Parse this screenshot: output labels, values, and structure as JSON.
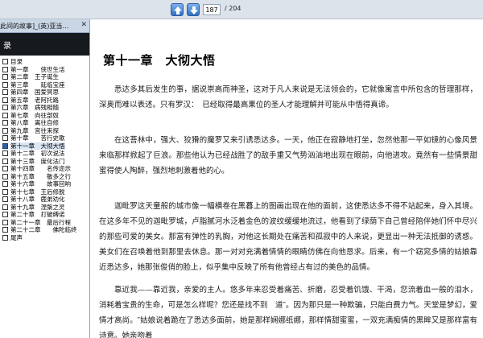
{
  "toolbar": {
    "page_value": "187",
    "page_total": "/ 204"
  },
  "tab": {
    "label": "此间的故事]_(英)亚当…",
    "close": "✕"
  },
  "sidebar": {
    "title": "录",
    "items": [
      "目录",
      "第一章　　侠世生活",
      "第二章　王子诞生",
      "第三章　　延临宝座",
      "第四章　国爱冥思",
      "第五章　老阿托路",
      "第六章　病残相随",
      "第七章　向往部奴",
      "第八章　离往自修",
      "第九章　宫往来探",
      "第十章　　苦行史歌",
      "第十一章　大彻大悟",
      "第十二章　初次说法",
      "第十三章　度化法门",
      "第十四章　　名传迩示",
      "第十五章　　敬多之行",
      "第十六章　　故事回响",
      "第十七章　王后修脱",
      "第十八章　鹿弟劝化",
      "第十九章　涅槃之灵",
      "第二十章　打破缚诺",
      "第二十一章　最后行程",
      "第二十二章　　佛陀临终",
      "尾声"
    ],
    "selected_index": 11
  },
  "content": {
    "title": "第十一章　大彻大悟",
    "paragraphs": [
      "悉达多其后发生的事，据说崇高而神圣，这对于凡人来说是无法领会的，它就像寓言中所包含的哲理那样，深奥而难以表述。只有罗汉：　已经取得最高果位的圣人才能理解并可能从中悟得真谛。",
      "在这菩林中，强大、狡猾的魔罗又来引诱悉达多。一天，他正在寂静地打坐，忽然他那一平如镜的心像风景来临那样掀起了巨浪。那些他认为已经战胜了的敌手重又气势汹汹地出现在眼前，向他进攻。竟然有一些情景甜蜜得使人陶醉，强烈地刺激着他的心。",
      "迦毗罗这天童般的城市像一幅横卷在黑暮上的图画出现在他的面前，这使悉达多不得不站起来，身入其境。在这多年不见的迦毗罗城，卢脂腻河水泛着金色的波纹缓缓地流过，他看到了绿荫下自己曾经陪伴她们怀中尽兴的那些可爱的美女。那富有弹性的乳胸，对他这长期处在痛苦和孤寂中的人来说，更显出一种无法抵御的诱惑。美女们在召唤着他到那里去休息。那一对对充满着情情的眼睛仿佛在向他恳求。后来，有一个窈窕多情的姑娘靠近悉达多，她那张俊俏的脸上，似乎集中反映了所有他曾经占有过的美色的品情。",
      "靠近我——靠近我，亲爱的主人。悠多年来忍受着痛苦、折磨，忍受着饥饿、干渴，您流着血一般的泪水，消耗着宝贵的生命，可是怎么样呢？您还是找不到　道″。因为那只是一种欺骗，只能白费力气。天堂是梦幻，爱情才高尚。″姑娘说着跪在了悉达多面前，她是那样娴娜纸娜，那样情甜蜜蜜，一双充满痴情的黑眸又是那样富有诗意。她亲吻着"
    ]
  },
  "colors": {
    "toolbar_bg": "#dde3ea",
    "sidebar_header_bg": "#16191d",
    "nav_button": "#2f6fc6",
    "selected_item": "#2f5fa8"
  },
  "icons": {
    "prev": "arrow-up-icon",
    "next": "arrow-down-icon",
    "close": "close-icon",
    "toc_node": "checkbox-icon"
  }
}
